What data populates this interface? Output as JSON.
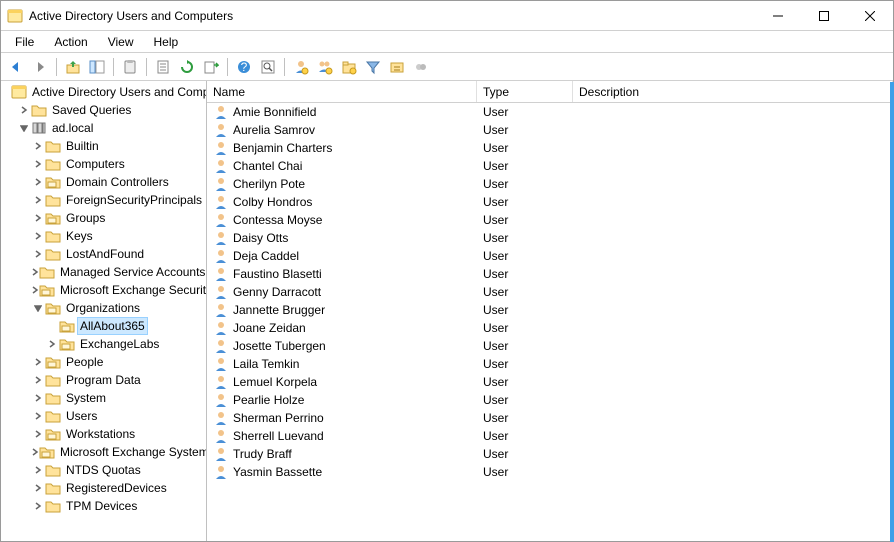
{
  "title": "Active Directory Users and Computers",
  "menu": {
    "file": "File",
    "action": "Action",
    "view": "View",
    "help": "Help"
  },
  "toolbar": {
    "back": "back-icon",
    "forward": "forward-icon",
    "up": "up-icon",
    "show_hide": "show-hide-tree-icon",
    "paste": "paste-icon",
    "properties": "properties-icon",
    "refresh": "refresh-icon",
    "export": "export-list-icon",
    "help": "help-icon",
    "find": "find-icon",
    "new_user": "new-user-icon",
    "new_group": "new-group-icon",
    "new_ou": "new-ou-icon",
    "filter": "filter-icon",
    "query": "saved-query-icon",
    "extra": "extra-icon"
  },
  "tree_root_label": "Active Directory Users and Computers",
  "tree": [
    {
      "depth": 1,
      "label": "Saved Queries",
      "icon": "folder",
      "expand": "closed"
    },
    {
      "depth": 1,
      "label": "ad.local",
      "icon": "domain",
      "expand": "open"
    },
    {
      "depth": 2,
      "label": "Builtin",
      "icon": "folder",
      "expand": "closed"
    },
    {
      "depth": 2,
      "label": "Computers",
      "icon": "folder",
      "expand": "closed"
    },
    {
      "depth": 2,
      "label": "Domain Controllers",
      "icon": "ou",
      "expand": "closed"
    },
    {
      "depth": 2,
      "label": "ForeignSecurityPrincipals",
      "icon": "folder",
      "expand": "closed"
    },
    {
      "depth": 2,
      "label": "Groups",
      "icon": "ou",
      "expand": "closed"
    },
    {
      "depth": 2,
      "label": "Keys",
      "icon": "folder",
      "expand": "closed"
    },
    {
      "depth": 2,
      "label": "LostAndFound",
      "icon": "folder",
      "expand": "closed"
    },
    {
      "depth": 2,
      "label": "Managed Service Accounts",
      "icon": "folder",
      "expand": "closed"
    },
    {
      "depth": 2,
      "label": "Microsoft Exchange Security Groups",
      "icon": "ou",
      "expand": "closed"
    },
    {
      "depth": 2,
      "label": "Organizations",
      "icon": "ou",
      "expand": "open"
    },
    {
      "depth": 3,
      "label": "AllAbout365",
      "icon": "ou",
      "expand": "none",
      "selected": true
    },
    {
      "depth": 3,
      "label": "ExchangeLabs",
      "icon": "ou",
      "expand": "closed"
    },
    {
      "depth": 2,
      "label": "People",
      "icon": "ou",
      "expand": "closed"
    },
    {
      "depth": 2,
      "label": "Program Data",
      "icon": "folder",
      "expand": "closed"
    },
    {
      "depth": 2,
      "label": "System",
      "icon": "folder",
      "expand": "closed"
    },
    {
      "depth": 2,
      "label": "Users",
      "icon": "folder",
      "expand": "closed"
    },
    {
      "depth": 2,
      "label": "Workstations",
      "icon": "ou",
      "expand": "closed"
    },
    {
      "depth": 2,
      "label": "Microsoft Exchange System Objects",
      "icon": "ou",
      "expand": "closed"
    },
    {
      "depth": 2,
      "label": "NTDS Quotas",
      "icon": "folder",
      "expand": "closed"
    },
    {
      "depth": 2,
      "label": "RegisteredDevices",
      "icon": "folder",
      "expand": "closed"
    },
    {
      "depth": 2,
      "label": "TPM Devices",
      "icon": "folder",
      "expand": "closed"
    }
  ],
  "columns": {
    "name": "Name",
    "type": "Type",
    "description": "Description"
  },
  "rows": [
    {
      "name": "Amie Bonnifield",
      "type": "User",
      "description": ""
    },
    {
      "name": "Aurelia Samrov",
      "type": "User",
      "description": ""
    },
    {
      "name": "Benjamin Charters",
      "type": "User",
      "description": ""
    },
    {
      "name": "Chantel Chai",
      "type": "User",
      "description": ""
    },
    {
      "name": "Cherilyn Pote",
      "type": "User",
      "description": ""
    },
    {
      "name": "Colby Hondros",
      "type": "User",
      "description": ""
    },
    {
      "name": "Contessa Moyse",
      "type": "User",
      "description": ""
    },
    {
      "name": "Daisy Otts",
      "type": "User",
      "description": ""
    },
    {
      "name": "Deja Caddel",
      "type": "User",
      "description": ""
    },
    {
      "name": "Faustino Blasetti",
      "type": "User",
      "description": ""
    },
    {
      "name": "Genny Darracott",
      "type": "User",
      "description": ""
    },
    {
      "name": "Jannette Brugger",
      "type": "User",
      "description": ""
    },
    {
      "name": "Joane Zeidan",
      "type": "User",
      "description": ""
    },
    {
      "name": "Josette Tubergen",
      "type": "User",
      "description": ""
    },
    {
      "name": "Laila Temkin",
      "type": "User",
      "description": ""
    },
    {
      "name": "Lemuel Korpela",
      "type": "User",
      "description": ""
    },
    {
      "name": "Pearlie Holze",
      "type": "User",
      "description": ""
    },
    {
      "name": "Sherman Perrino",
      "type": "User",
      "description": ""
    },
    {
      "name": "Sherrell Luevand",
      "type": "User",
      "description": ""
    },
    {
      "name": "Trudy Braff",
      "type": "User",
      "description": ""
    },
    {
      "name": "Yasmin Bassette",
      "type": "User",
      "description": ""
    }
  ]
}
